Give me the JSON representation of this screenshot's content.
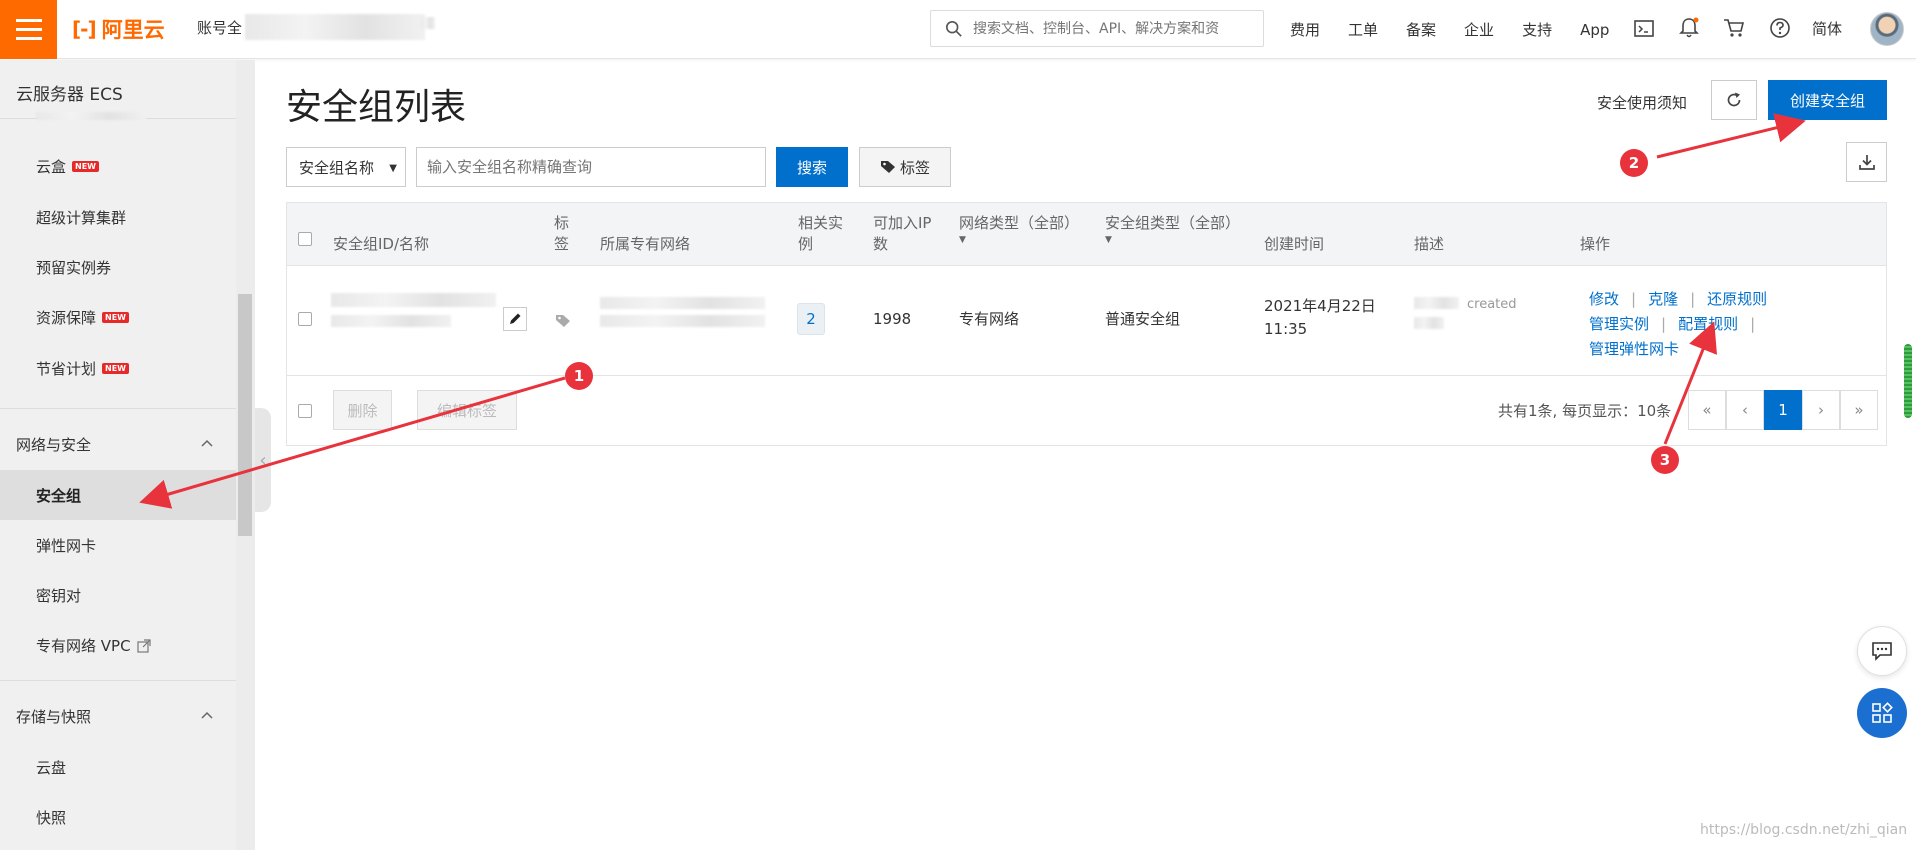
{
  "header": {
    "brand": "阿里云",
    "brand_mark": "[-]",
    "account_label": "账号全",
    "search_placeholder": "搜索文档、控制台、API、解决方案和资",
    "nav": [
      "费用",
      "工单",
      "备案",
      "企业",
      "支持",
      "App"
    ],
    "language": "简体",
    "icons": [
      "terminal-icon",
      "bell-icon",
      "cart-icon",
      "help-icon"
    ]
  },
  "sidebar": {
    "title": "云服务器 ECS",
    "items_top": [
      {
        "label": "云盒",
        "badge": "NEW"
      },
      {
        "label": "超级计算集群",
        "badge": ""
      },
      {
        "label": "预留实例券",
        "badge": ""
      },
      {
        "label": "资源保障",
        "badge": "NEW"
      },
      {
        "label": "节省计划",
        "badge": "NEW"
      }
    ],
    "group_network": "网络与安全",
    "items_network": [
      {
        "label": "安全组"
      },
      {
        "label": "弹性网卡"
      },
      {
        "label": "密钥对"
      },
      {
        "label": "专有网络 VPC"
      }
    ],
    "group_storage": "存储与快照",
    "items_storage": [
      {
        "label": "云盘"
      },
      {
        "label": "快照"
      }
    ]
  },
  "page": {
    "title": "安全组列表",
    "notice_link": "安全使用须知",
    "create_button": "创建安全组",
    "filter_select": "安全组名称",
    "filter_placeholder": "输入安全组名称精确查询",
    "search_button": "搜索",
    "tag_button": "标签"
  },
  "table": {
    "headers": {
      "id_name": "安全组ID/名称",
      "tag_1": "标",
      "tag_2": "签",
      "vpc": "所属专有网络",
      "instances_1": "相关实",
      "instances_2": "例",
      "ip_1": "可加入IP",
      "ip_2": "数",
      "net_type": "网络类型（全部）",
      "sg_type": "安全组类型（全部）",
      "created": "创建时间",
      "desc": "描述",
      "ops": "操作"
    },
    "row": {
      "instances": "2",
      "ip_count": "1998",
      "net_type": "专有网络",
      "sg_type": "普通安全组",
      "created_date": "2021年4月22日",
      "created_time": "11:35",
      "desc_fragment": "created",
      "ops": [
        "修改",
        "克隆",
        "还原规则",
        "管理实例",
        "配置规则",
        "管理弹性网卡"
      ]
    },
    "footer": {
      "delete_button": "删除",
      "edit_tags_button": "编辑标签",
      "summary": "共有1条, 每页显示：10条",
      "pager": [
        "«",
        "‹",
        "1",
        "›",
        "»"
      ]
    }
  },
  "annotations": [
    "1",
    "2",
    "3"
  ],
  "watermark": "https://blog.csdn.net/zhi_qian",
  "colors": {
    "accent": "#ff6a00",
    "primary": "#0070cc",
    "marker": "#e8323c"
  }
}
